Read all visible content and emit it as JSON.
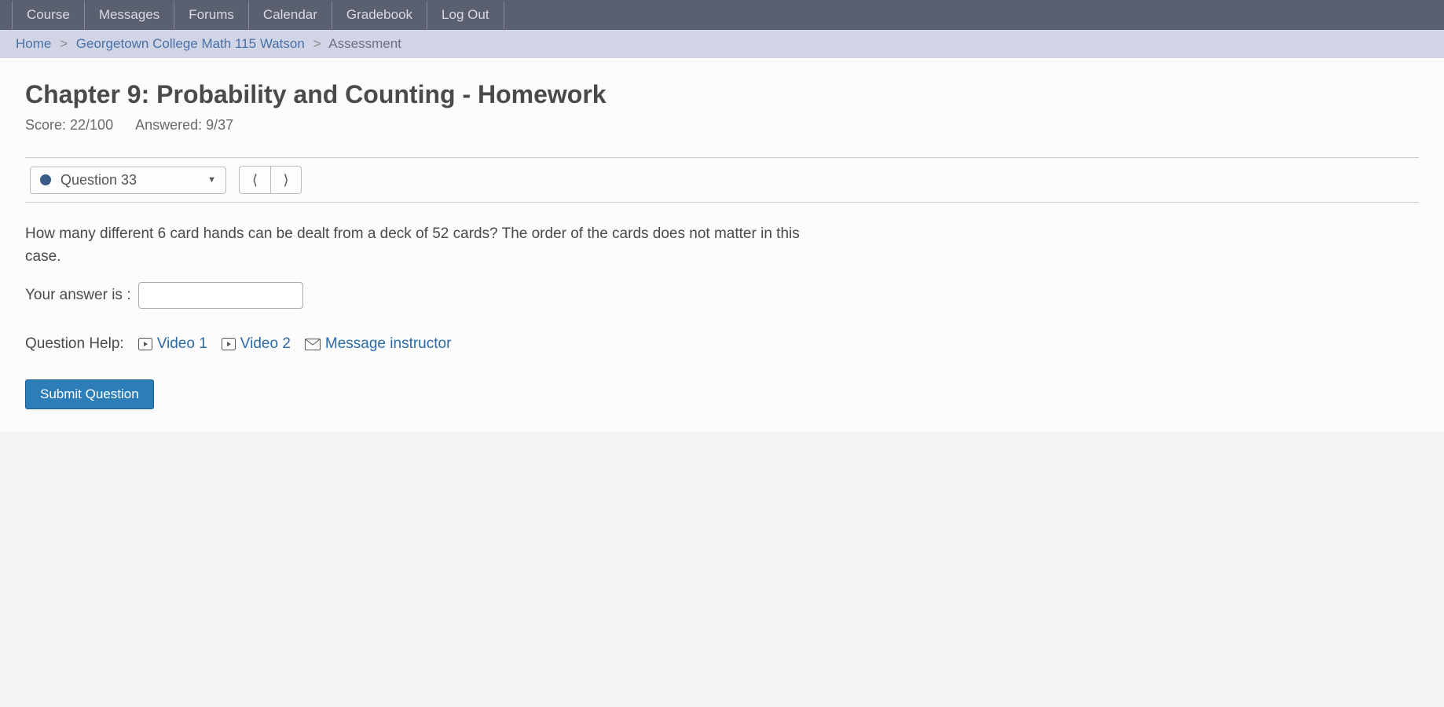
{
  "nav": {
    "tabs": [
      "Course",
      "Messages",
      "Forums",
      "Calendar",
      "Gradebook",
      "Log Out"
    ]
  },
  "breadcrumb": {
    "home": "Home",
    "course": "Georgetown College Math 115 Watson",
    "current": "Assessment",
    "sep": ">"
  },
  "page": {
    "title": "Chapter 9: Probability and Counting - Homework",
    "score_label": "Score: 22/100",
    "answered_label": "Answered: 9/37"
  },
  "question_nav": {
    "label": "Question 33"
  },
  "question": {
    "text": "How many different 6 card hands can be dealt from a deck of 52 cards? The order of the cards does not matter in this case.",
    "answer_label": "Your answer is :",
    "answer_value": ""
  },
  "help": {
    "label": "Question Help:",
    "video1": "Video 1",
    "video2": "Video 2",
    "message": "Message instructor"
  },
  "submit": {
    "label": "Submit Question"
  }
}
